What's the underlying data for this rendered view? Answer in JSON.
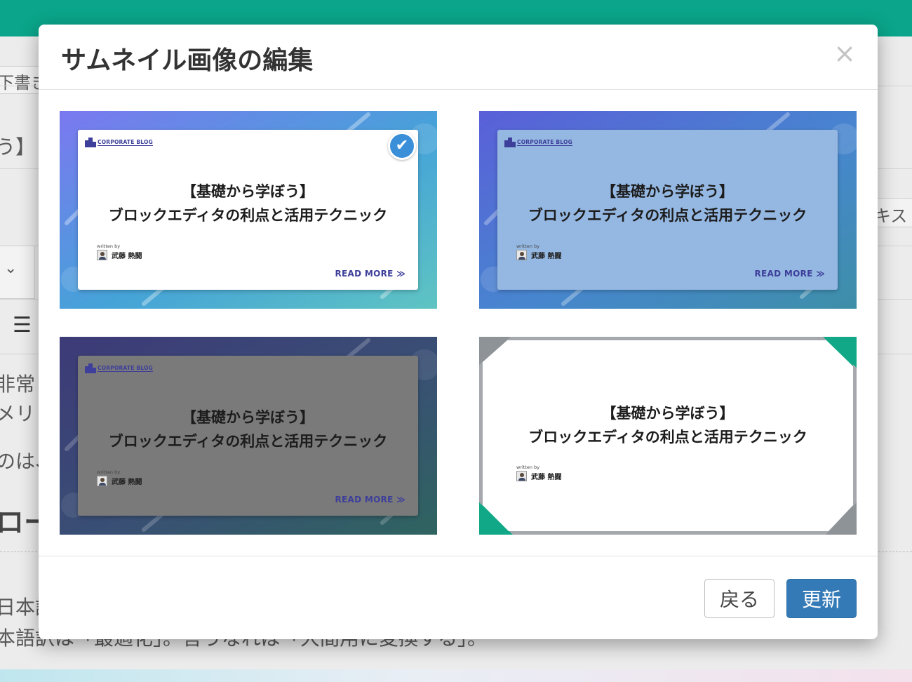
{
  "background": {
    "fragments": [
      "下書き",
      "う】",
      "キスト",
      "非常",
      "メリッ",
      "のは、",
      "ロー",
      "日本語",
      "本語訳は「最適化」。言うなれば「大間用に変換する」。"
    ]
  },
  "modal": {
    "title": "サムネイル画像の編集",
    "close_glyph": "×",
    "back_label": "戻る",
    "update_label": "更新",
    "check_glyph": "✔"
  },
  "thumbnail": {
    "logo_label": "CORPORATE BLOG",
    "title_line1": "【基礎から学ぼう】",
    "title_line2": "ブロックエディタの利点と活用テクニック",
    "written_by": "written by",
    "author": "武藤 熱闘",
    "read_more": "READ MORE ≫"
  },
  "options": [
    {
      "style": "gradient-blue-white-card",
      "selected": true
    },
    {
      "style": "gradient-blue-light-card",
      "selected": false
    },
    {
      "style": "dark-gradient-gray-card",
      "selected": false
    },
    {
      "style": "white-with-corner-triangles",
      "selected": false
    }
  ],
  "colors": {
    "topbar": "#0aa58a",
    "primary_button": "#337ab7",
    "check_badge": "#3b8fd8",
    "brand_text": "#3d3f9a",
    "corner_green": "#10a886",
    "corner_gray": "#8e9398"
  },
  "icons": {
    "close": "close-icon",
    "check": "check-icon",
    "logo": "building-icon",
    "avatar": "user-avatar-icon"
  }
}
